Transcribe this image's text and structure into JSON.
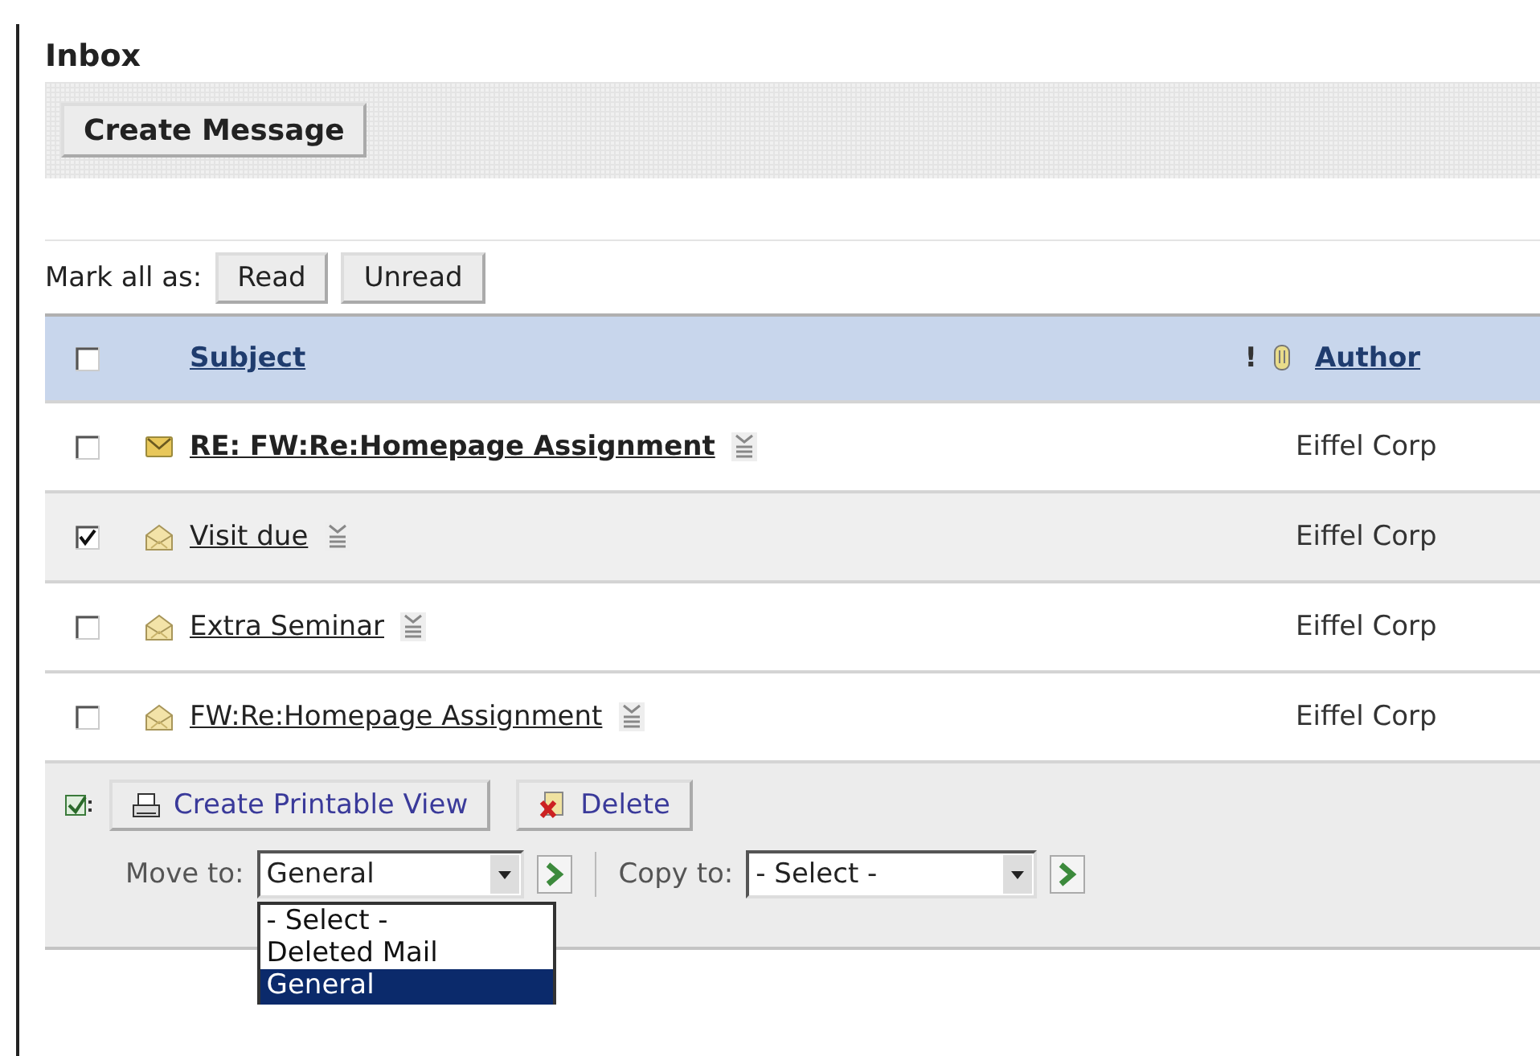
{
  "page_title": "Inbox",
  "toolbar": {
    "create_button": "Create Message"
  },
  "mark_all": {
    "label": "Mark all as:",
    "buttons": [
      "Read",
      "Unread"
    ]
  },
  "table": {
    "select_all": {
      "checked": false
    },
    "columns": {
      "subject": "Subject",
      "priority": "!",
      "author": "Author"
    },
    "rows": [
      {
        "subject": "RE: FW:Re:Homepage Assignment",
        "author": "Eiffel Corp",
        "read": false,
        "checked": false
      },
      {
        "subject": "Visit due",
        "author": "Eiffel Corp",
        "read": true,
        "checked": true
      },
      {
        "subject": "Extra Seminar",
        "author": "Eiffel Corp",
        "read": true,
        "checked": false
      },
      {
        "subject": "FW:Re:Homepage Assignment",
        "author": "Eiffel Corp",
        "read": true,
        "checked": false
      }
    ]
  },
  "actions": {
    "printable_button": "Create Printable View",
    "delete_button": "Delete",
    "move_to": {
      "label": "Move to:",
      "value": "General",
      "options": [
        {
          "label": "- Select -",
          "selected": false
        },
        {
          "label": "Deleted Mail",
          "selected": false
        },
        {
          "label": "General",
          "selected": true
        }
      ]
    },
    "copy_to": {
      "label": "Copy to:",
      "value": "- Select -"
    }
  }
}
